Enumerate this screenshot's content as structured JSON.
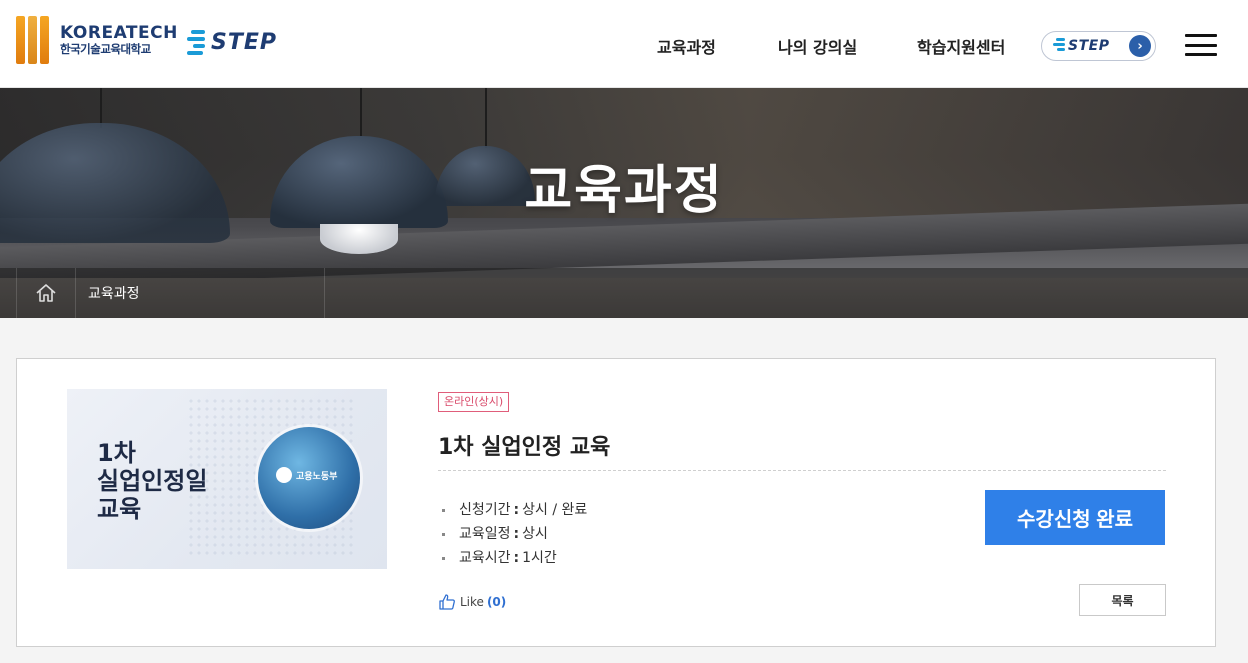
{
  "header": {
    "logo_name": "KOREATECH",
    "logo_sub": "한국기술교육대학교",
    "step_logo": "STEP",
    "nav": [
      "교육과정",
      "나의 강의실",
      "학습지원센터"
    ],
    "step_pill": "STEP",
    "icons": [
      "koreatech-emblem-icon",
      "step-logo-icon",
      "arrow-right-icon",
      "hamburger-menu-icon"
    ]
  },
  "banner": {
    "title": "교육과정",
    "breadcrumb": "교육과정",
    "home_icon": "home-icon"
  },
  "course": {
    "thumbnail_title": "1차\n실업인정일\n교육",
    "thumbnail_badge": "고용노동부",
    "tag": "온라인(상시)",
    "title": "1차 실업인정 교육",
    "info": [
      {
        "label": "신청기간",
        "value": "상시 / 완료"
      },
      {
        "label": "교육일정",
        "value": "상시"
      },
      {
        "label": "교육시간",
        "value": "1시간"
      }
    ],
    "apply_button": "수강신청 완료",
    "like_label": "Like",
    "like_count": "(0)",
    "list_button": "목록"
  },
  "colors": {
    "accent": "#2f80e8",
    "tag": "#d94a6a",
    "brand_navy": "#1e3c72"
  }
}
